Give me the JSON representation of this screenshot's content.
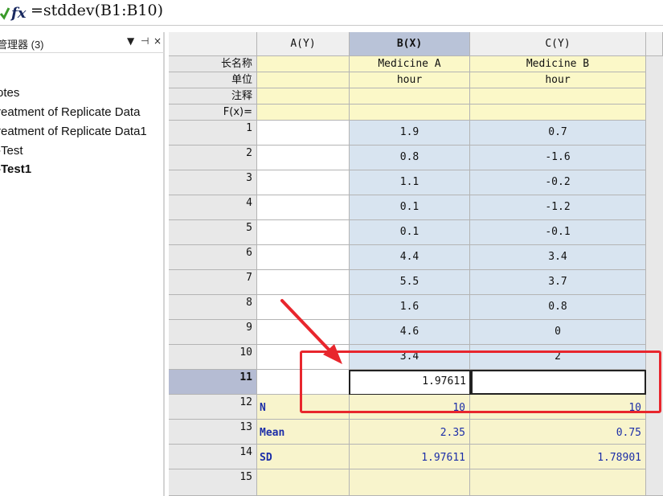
{
  "formula_bar": {
    "icon": "fx-icon",
    "formula": "=stddev(B1:B10)"
  },
  "left_panel": {
    "title": "管理器 (3)",
    "buttons": [
      "▼",
      "⊣",
      "×"
    ],
    "items": [
      {
        "label": "otes",
        "bold": false
      },
      {
        "label": "reatment of Replicate Data",
        "bold": false
      },
      {
        "label": "reatment of Replicate Data1",
        "bold": false
      },
      {
        "label": "-Test",
        "bold": false
      },
      {
        "label": "-Test1",
        "bold": true
      }
    ]
  },
  "sheet": {
    "columns": [
      "A(Y)",
      "B(X)",
      "C(Y)"
    ],
    "selected_column": "B(X)",
    "meta_labels": [
      "长名称",
      "单位",
      "注释",
      "F(x)="
    ],
    "meta": {
      "long_name": [
        "",
        "Medicine A",
        "Medicine B"
      ],
      "unit": [
        "",
        "hour",
        "hour"
      ],
      "comment": [
        "",
        "",
        ""
      ],
      "fx": [
        "",
        "",
        ""
      ]
    },
    "row_numbers": [
      "1",
      "2",
      "3",
      "4",
      "5",
      "6",
      "7",
      "8",
      "9",
      "10",
      "11",
      "12",
      "13",
      "14",
      "15"
    ],
    "selected_row": "11",
    "col_b": [
      "1.9",
      "0.8",
      "1.1",
      "0.1",
      "0.1",
      "4.4",
      "5.5",
      "1.6",
      "4.6",
      "3.4"
    ],
    "col_c": [
      "0.7",
      "-1.6",
      "-0.2",
      "-1.2",
      "-0.1",
      "3.4",
      "3.7",
      "0.8",
      "0",
      "2"
    ],
    "active_cell_value": "1.97611",
    "stats": [
      {
        "label": "N",
        "b": "10",
        "c": "10"
      },
      {
        "label": "Mean",
        "b": "2.35",
        "c": "0.75"
      },
      {
        "label": "SD",
        "b": "1.97611",
        "c": "1.78901"
      }
    ]
  },
  "annotation": {
    "color": "#e8262d"
  }
}
